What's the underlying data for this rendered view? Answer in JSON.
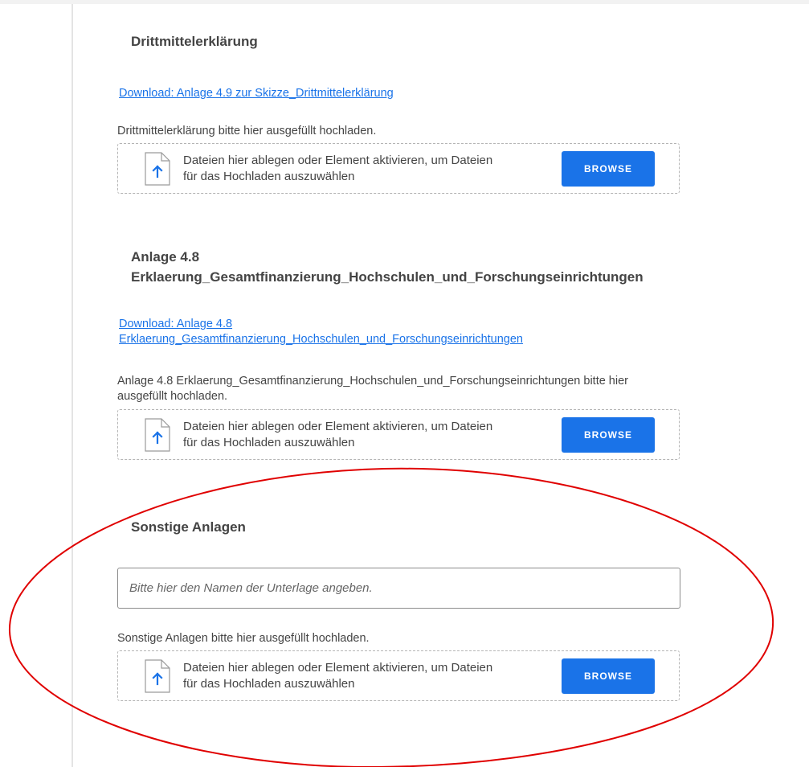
{
  "sections": [
    {
      "title": "Drittmittelerklärung",
      "download_link": "Download: Anlage 4.9 zur Skizze_Drittmittelerklärung",
      "upload_hint": "Drittmittelerklärung bitte hier ausgefüllt hochladen.",
      "dropzone_text": "Dateien hier ablegen oder Element aktivieren, um Dateien für das Hochladen auszuwählen",
      "browse_label": "BROWSE"
    },
    {
      "title_line1": "Anlage 4.8",
      "title_line2": "Erklaerung_Gesamtfinanzierung_Hochschulen_und_Forschungseinrichtungen",
      "download_link_line1": "Download: Anlage 4.8",
      "download_link_line2": "Erklaerung_Gesamtfinanzierung_Hochschulen_und_Forschungseinrichtungen",
      "upload_hint": "Anlage 4.8 Erklaerung_Gesamtfinanzierung_Hochschulen_und_Forschungseinrichtungen bitte hier ausgefüllt hochladen.",
      "dropzone_text": "Dateien hier ablegen oder Element aktivieren, um Dateien für das Hochladen auszuwählen",
      "browse_label": "BROWSE"
    },
    {
      "title": "Sonstige Anlagen",
      "name_input": {
        "value": "",
        "placeholder": "Bitte hier den Namen der Unterlage angeben."
      },
      "upload_hint": "Sonstige Anlagen bitte hier ausgefüllt hochladen.",
      "dropzone_text": "Dateien hier ablegen oder Element aktivieren, um Dateien für das Hochladen auszuwählen",
      "browse_label": "BROWSE"
    }
  ],
  "icons": {
    "upload": "file-upload-icon",
    "annotation": "red-ellipse-annotation"
  },
  "colors": {
    "accent": "#1a73e8",
    "text": "#444444",
    "annotation": "#e00000",
    "border": "#b5b5b5",
    "page_background": "#f2f2f2"
  }
}
